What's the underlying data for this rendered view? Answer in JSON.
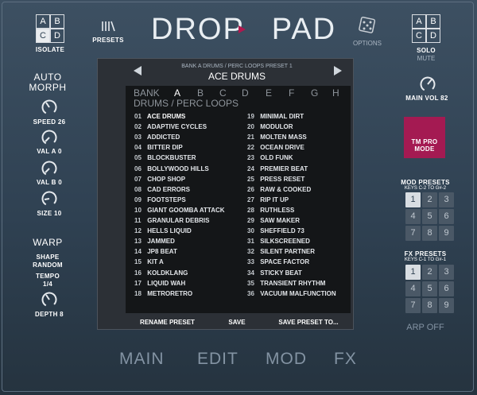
{
  "app": {
    "title_left": "DROP",
    "title_right": "PAD"
  },
  "top": {
    "isolate": {
      "cells": [
        "A",
        "B",
        "C",
        "D"
      ],
      "active_index": 2,
      "label": "ISOLATE"
    },
    "solo": {
      "cells": [
        "A",
        "B",
        "C",
        "D"
      ],
      "label": "SOLO",
      "sub": "MUTE"
    },
    "presets_label": "PRESETS",
    "options_label": "OPTIONS"
  },
  "left": {
    "auto_morph": "AUTO\nMORPH",
    "speed": "SPEED 26",
    "val_a": "VAL A 0",
    "val_b": "VAL B 0",
    "size": "SIZE 10",
    "warp": "WARP",
    "shape": "SHAPE\nRANDOM",
    "tempo": "TEMPO\n1/4",
    "depth": "DEPTH 8"
  },
  "browser": {
    "crumb": "BANK A   DRUMS / PERC LOOPS   PRESET 1",
    "current": "ACE DRUMS",
    "bank_label": "BANK",
    "banks": [
      "A",
      "B",
      "C",
      "D",
      "E",
      "F",
      "G",
      "H"
    ],
    "active_bank": 0,
    "category": "DRUMS / PERC LOOPS",
    "col1": [
      {
        "n": "01",
        "name": "ACE DRUMS"
      },
      {
        "n": "02",
        "name": "ADAPTIVE CYCLES"
      },
      {
        "n": "03",
        "name": "ADDICTED"
      },
      {
        "n": "04",
        "name": "BITTER DIP"
      },
      {
        "n": "05",
        "name": "BLOCKBUSTER"
      },
      {
        "n": "06",
        "name": "BOLLYWOOD HILLS"
      },
      {
        "n": "07",
        "name": "CHOP SHOP"
      },
      {
        "n": "08",
        "name": "CAD ERRORS"
      },
      {
        "n": "09",
        "name": "FOOTSTEPS"
      },
      {
        "n": "10",
        "name": "GIANT GOOMBA ATTACK"
      },
      {
        "n": "11",
        "name": "GRANULAR DEBRIS"
      },
      {
        "n": "12",
        "name": "HELLS LIQUID"
      },
      {
        "n": "13",
        "name": "JAMMED"
      },
      {
        "n": "14",
        "name": "JP8 BEAT"
      },
      {
        "n": "15",
        "name": "KIT A"
      },
      {
        "n": "16",
        "name": "KOLDKLANG"
      },
      {
        "n": "17",
        "name": "LIQUID WAH"
      },
      {
        "n": "18",
        "name": "METRORETRO"
      }
    ],
    "col2": [
      {
        "n": "19",
        "name": "MINIMAL DIRT"
      },
      {
        "n": "20",
        "name": "MODULOR"
      },
      {
        "n": "21",
        "name": "MOLTEN MASS"
      },
      {
        "n": "22",
        "name": "OCEAN DRIVE"
      },
      {
        "n": "23",
        "name": "OLD FUNK"
      },
      {
        "n": "24",
        "name": "PREMIER BEAT"
      },
      {
        "n": "25",
        "name": "PRESS RESET"
      },
      {
        "n": "26",
        "name": "RAW & COOKED"
      },
      {
        "n": "27",
        "name": "RIP IT UP"
      },
      {
        "n": "28",
        "name": "RUTHLESS"
      },
      {
        "n": "29",
        "name": "SAW MAKER"
      },
      {
        "n": "30",
        "name": "SHEFFIELD 73"
      },
      {
        "n": "31",
        "name": "SILKSCREENED"
      },
      {
        "n": "32",
        "name": "SILENT PARTNER"
      },
      {
        "n": "33",
        "name": "SPACE FACTOR"
      },
      {
        "n": "34",
        "name": "STICKY BEAT"
      },
      {
        "n": "35",
        "name": "TRANSIENT RHYTHM"
      },
      {
        "n": "36",
        "name": "VACUUM MALFUNCTION"
      }
    ],
    "rename": "RENAME PRESET",
    "save": "SAVE",
    "save_to": "SAVE PRESET TO..."
  },
  "right": {
    "main_vol": "MAIN VOL 82",
    "tm_pro": "TM PRO\nMODE",
    "mod_presets": "MOD PRESETS",
    "mod_keys": "KEYS C-2 TO G#-2",
    "fx_presets": "FX PRESETS",
    "fx_keys": "KEYS C-1 TO G#-1",
    "nums": [
      "1",
      "2",
      "3",
      "4",
      "5",
      "6",
      "7",
      "8",
      "9"
    ],
    "arp": "ARP OFF"
  },
  "tabs": [
    "MAIN",
    "EDIT",
    "MOD",
    "FX"
  ],
  "colors": {
    "accent": "#b0184e",
    "panel": "#2c3036",
    "bg": "#2f4152"
  }
}
